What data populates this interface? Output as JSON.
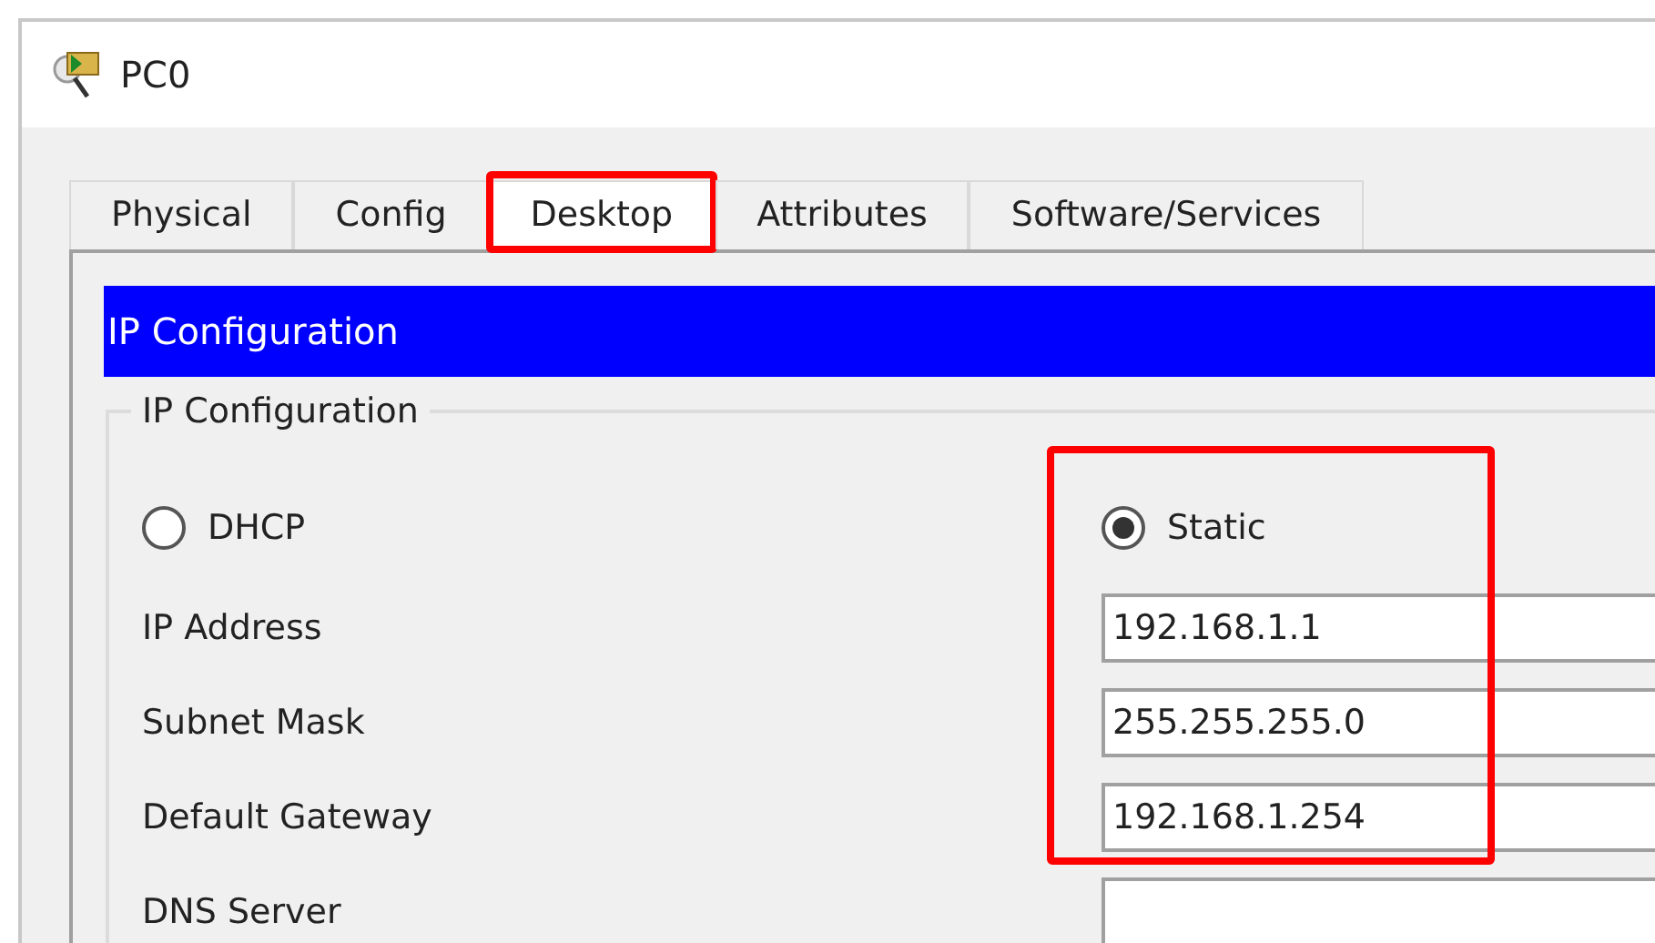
{
  "window": {
    "title": "PC0"
  },
  "tabs": [
    {
      "label": "Physical",
      "selected": false,
      "highlighted": false
    },
    {
      "label": "Config",
      "selected": false,
      "highlighted": false
    },
    {
      "label": "Desktop",
      "selected": true,
      "highlighted": true
    },
    {
      "label": "Attributes",
      "selected": false,
      "highlighted": false
    },
    {
      "label": "Software/Services",
      "selected": false,
      "highlighted": false
    }
  ],
  "header": "IP Configuration",
  "group": {
    "legend": "IP Configuration",
    "modes": [
      {
        "label": "DHCP",
        "selected": false
      },
      {
        "label": "Static",
        "selected": true
      }
    ],
    "static_highlighted": true,
    "fields": [
      {
        "label": "IP Address",
        "value": "192.168.1.1"
      },
      {
        "label": "Subnet Mask",
        "value": "255.255.255.0"
      },
      {
        "label": "Default Gateway",
        "value": "192.168.1.254"
      },
      {
        "label": "DNS Server"
      }
    ]
  }
}
